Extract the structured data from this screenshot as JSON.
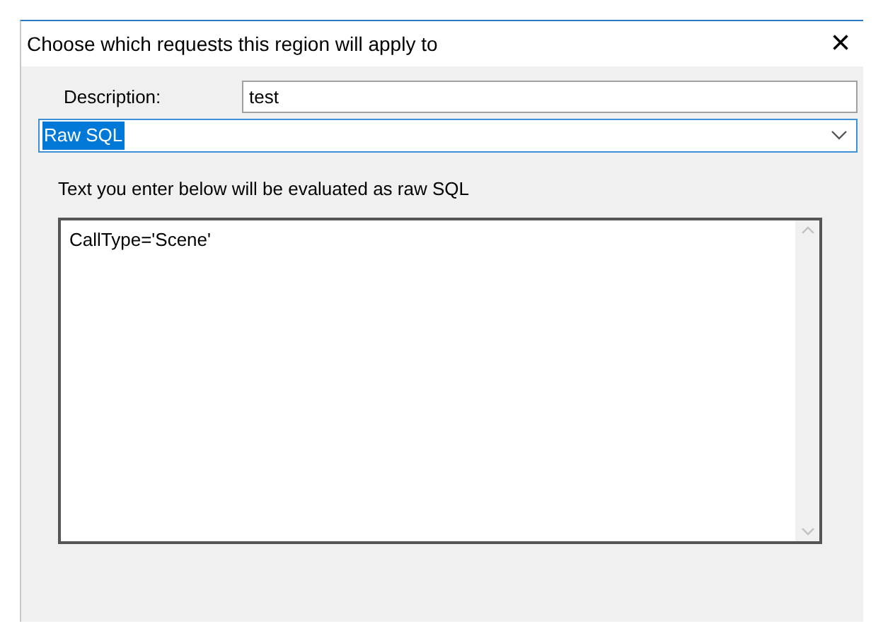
{
  "window": {
    "title": "Choose which requests this region will apply to",
    "close": "×"
  },
  "description": {
    "label": "Description:",
    "value": "test"
  },
  "mode_dropdown": {
    "value": "Raw SQL",
    "focused": true
  },
  "hint": "Text you enter below will be evaluated as raw SQL",
  "sql_editor": {
    "value": "CallType='Scene'"
  }
}
